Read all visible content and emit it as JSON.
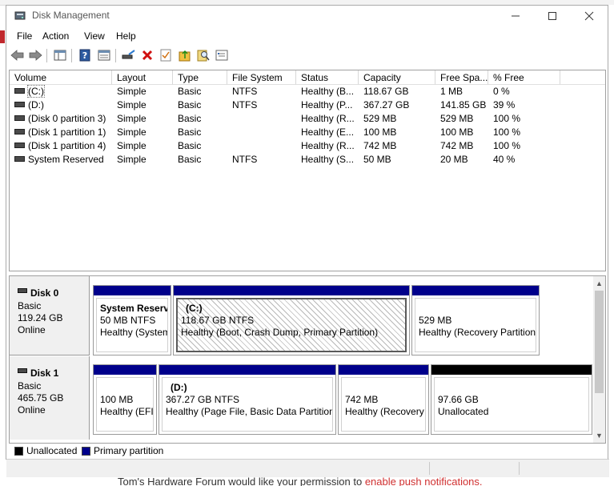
{
  "window": {
    "title": "Disk Management"
  },
  "menu": [
    "File",
    "Action",
    "View",
    "Help"
  ],
  "volume_table": {
    "columns": [
      "Volume",
      "Layout",
      "Type",
      "File System",
      "Status",
      "Capacity",
      "Free Spa...",
      "% Free"
    ],
    "rows": [
      [
        "(C:)",
        "Simple",
        "Basic",
        "NTFS",
        "Healthy (B...",
        "118.67 GB",
        "1 MB",
        "0 %"
      ],
      [
        "(D:)",
        "Simple",
        "Basic",
        "NTFS",
        "Healthy (P...",
        "367.27 GB",
        "141.85 GB",
        "39 %"
      ],
      [
        "(Disk 0 partition 3)",
        "Simple",
        "Basic",
        "",
        "Healthy (R...",
        "529 MB",
        "529 MB",
        "100 %"
      ],
      [
        "(Disk 1 partition 1)",
        "Simple",
        "Basic",
        "",
        "Healthy (E...",
        "100 MB",
        "100 MB",
        "100 %"
      ],
      [
        "(Disk 1 partition 4)",
        "Simple",
        "Basic",
        "",
        "Healthy (R...",
        "742 MB",
        "742 MB",
        "100 %"
      ],
      [
        "System Reserved",
        "Simple",
        "Basic",
        "NTFS",
        "Healthy (S...",
        "50 MB",
        "20 MB",
        "40 %"
      ]
    ]
  },
  "disks": [
    {
      "name": "Disk 0",
      "type": "Basic",
      "size": "119.24 GB",
      "state": "Online",
      "partitions": [
        {
          "title": "System Reserve",
          "size": "50 MB NTFS",
          "status": "Healthy (System"
        },
        {
          "title": "(C:)",
          "size": "118.67 GB NTFS",
          "status": "Healthy (Boot, Crash Dump, Primary Partition)"
        },
        {
          "title": "",
          "size": "529 MB",
          "status": "Healthy (Recovery Partition)"
        }
      ]
    },
    {
      "name": "Disk 1",
      "type": "Basic",
      "size": "465.75 GB",
      "state": "Online",
      "partitions": [
        {
          "title": "",
          "size": "100 MB",
          "status": "Healthy (EFI"
        },
        {
          "title": "(D:)",
          "size": "367.27 GB NTFS",
          "status": "Healthy (Page File, Basic Data Partition)"
        },
        {
          "title": "",
          "size": "742 MB",
          "status": "Healthy (Recovery"
        },
        {
          "title": "",
          "size": "97.66 GB",
          "status": "Unallocated"
        }
      ]
    }
  ],
  "legend": [
    "Unallocated",
    "Primary partition"
  ],
  "background": {
    "notice_prefix": "Tom's Hardware Forum would like your permission to ",
    "notice_link": "enable push notifications."
  }
}
